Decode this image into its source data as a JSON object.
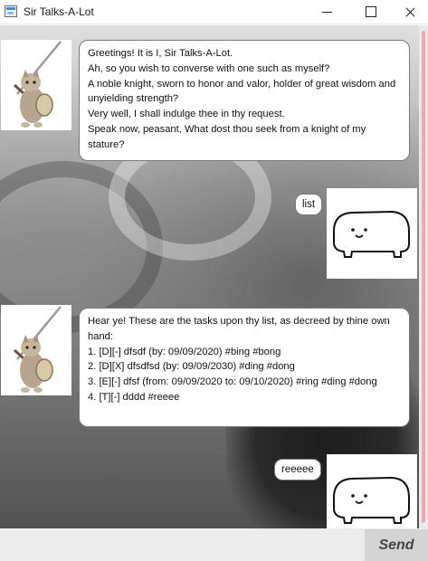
{
  "window": {
    "title": "Sir Talks-A-Lot",
    "app_icon": "window-app-icon",
    "controls": [
      "minimize-icon",
      "maximize-icon",
      "close-icon"
    ]
  },
  "messages": [
    {
      "sender": "bot",
      "text": "Greetings! It is I, Sir Talks-A-Lot.\nAh, so you wish to converse with one such as myself?\nA noble knight, sworn to honor and valor, holder of great wisdom and unyielding strength?\nVery well, I shall indulge thee in thy request.\nSpeak now, peasant, What dost thou seek from a knight of my stature?",
      "avatar": "knight-cat-avatar"
    },
    {
      "sender": "user",
      "text": "list",
      "avatar": "blob-creature-avatar"
    },
    {
      "sender": "bot",
      "text": "Hear ye! These are the tasks upon thy list, as decreed by thine own hand:\n1. [D][-] dfsdf (by: 09/09/2020) #bing #bong\n2. [D][X] dfsdfsd (by: 09/09/2030) #ding #dong\n3. [E][-] dfsf (from: 09/09/2020 to: 09/10/2020) #ring #ding #dong\n4. [T][-] dddd #reeee",
      "avatar": "knight-cat-avatar"
    },
    {
      "sender": "user",
      "text": "reeeee",
      "avatar": "blob-creature-avatar"
    }
  ],
  "input": {
    "value": "",
    "placeholder": ""
  },
  "send_label": "Send",
  "colors": {
    "scroll_thumb": "#f2a8b4",
    "bubble_bg": "#ffffff",
    "bubble_border": "#7a7a7a",
    "input_bg": "#ececec",
    "send_bg": "#d4d4d4"
  }
}
